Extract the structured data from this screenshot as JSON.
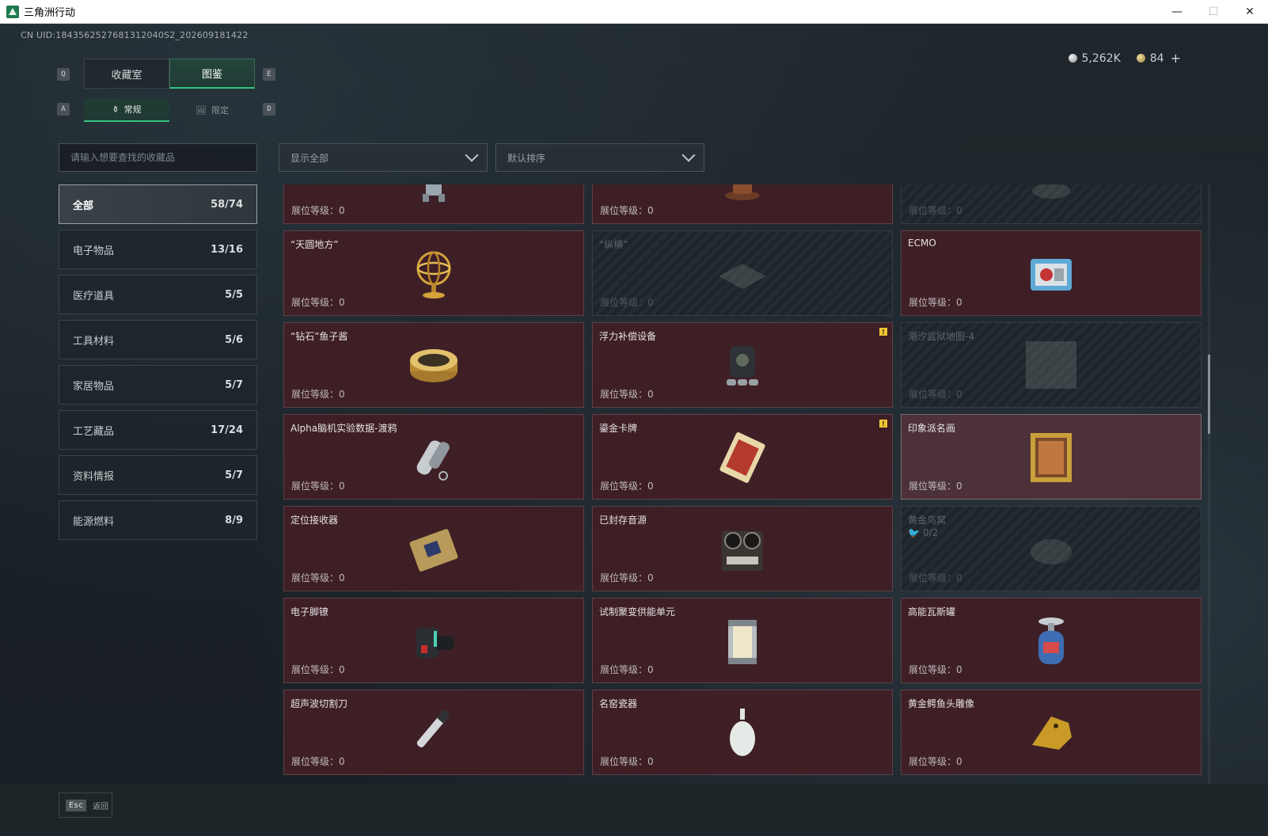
{
  "window": {
    "title": "三角洲行动",
    "minimize": "—",
    "maximize": "☐",
    "close": "✕"
  },
  "uid": "CN UID:1843562527681312040S2_202609181422",
  "currency": {
    "silver": "5,262K",
    "gold": "84",
    "add": "+"
  },
  "keys": {
    "prev_tab": "Q",
    "next_tab": "E",
    "prev_sub": "A",
    "next_sub": "D",
    "back": "Esc"
  },
  "tabs": [
    {
      "label": "收藏室"
    },
    {
      "label": "图鉴"
    }
  ],
  "subtabs": [
    {
      "label": "常规",
      "icon": "⚱"
    },
    {
      "label": "限定",
      "icon": "🖼"
    }
  ],
  "search": {
    "placeholder": "请输入想要查找的收藏品"
  },
  "filters": {
    "show": "显示全部",
    "sort": "默认排序"
  },
  "categories": [
    {
      "label": "全部",
      "count": "58/74"
    },
    {
      "label": "电子物品",
      "count": "13/16"
    },
    {
      "label": "医疗道具",
      "count": "5/5"
    },
    {
      "label": "工具材料",
      "count": "5/6"
    },
    {
      "label": "家居物品",
      "count": "5/7"
    },
    {
      "label": "工艺藏品",
      "count": "17/24"
    },
    {
      "label": "资料情报",
      "count": "5/7"
    },
    {
      "label": "能源燃料",
      "count": "8/9"
    }
  ],
  "level_label": "展位等级：0",
  "items": [
    {
      "name": "",
      "icon": "robot-figure-icon"
    },
    {
      "name": "",
      "icon": "tea-set-icon"
    },
    {
      "name": "",
      "icon": "locked-item-icon"
    },
    {
      "name": "“天圆地方”",
      "icon": "armillary-sphere-icon"
    },
    {
      "name": "“纵横”",
      "icon": "chessboard-icon"
    },
    {
      "name": "ECMO",
      "icon": "ecmo-machine-icon"
    },
    {
      "name": "“钻石”鱼子酱",
      "icon": "caviar-tin-icon"
    },
    {
      "name": "浮力补偿设备",
      "icon": "buoyancy-device-icon"
    },
    {
      "name": "潮汐监狱地图-4",
      "icon": "map-icon"
    },
    {
      "name": "Alpha脑机实验数据-渡鸦",
      "icon": "data-capsule-icon"
    },
    {
      "name": "鎏金卡牌",
      "icon": "gilded-card-icon"
    },
    {
      "name": "印象派名画",
      "icon": "framed-painting-icon"
    },
    {
      "name": "定位接收器",
      "icon": "gps-receiver-icon"
    },
    {
      "name": "已封存音源",
      "icon": "reel-to-reel-icon"
    },
    {
      "name": "黄金鸟窝",
      "sub": "0/2",
      "icon": "golden-nest-icon"
    },
    {
      "name": "电子脚镣",
      "icon": "ankle-monitor-icon"
    },
    {
      "name": "试制聚变供能单元",
      "icon": "fusion-cell-icon"
    },
    {
      "name": "高能瓦斯罐",
      "icon": "gas-canister-icon"
    },
    {
      "name": "超声波切割刀",
      "icon": "ultrasonic-cutter-icon"
    },
    {
      "name": "名窑瓷器",
      "icon": "porcelain-vase-icon"
    },
    {
      "name": "黄金鳄鱼头雕像",
      "icon": "golden-crocodile-icon"
    }
  ],
  "back_label": "返回",
  "colors": {
    "accent": "#34c182",
    "card_bg": "#3e1f26",
    "warning": "#f2c631"
  }
}
